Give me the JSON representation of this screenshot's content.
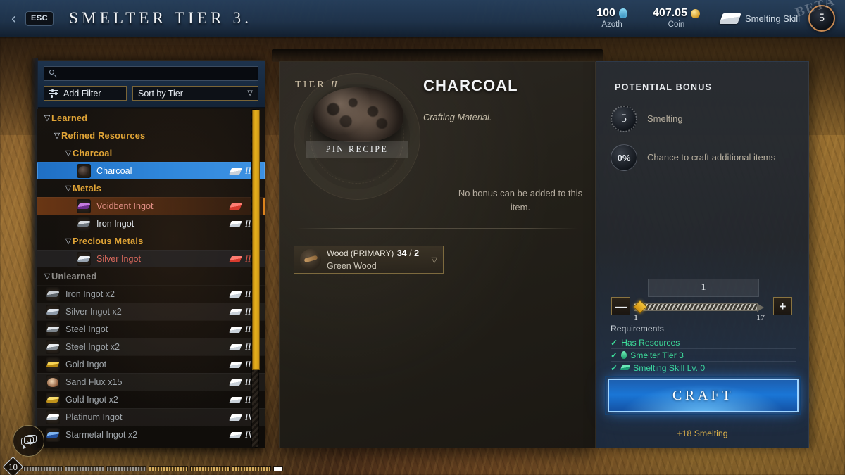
{
  "header": {
    "back_icon": "chevron-left-icon",
    "esc_key": "ESC",
    "title": "SMELTER TIER 3.",
    "azoth_value": "100",
    "azoth_label": "Azoth",
    "coin_value": "407.05",
    "coin_label": "Coin",
    "skill_label": "Smelting Skill",
    "skill_level": "5",
    "watermark": "BETA"
  },
  "sidebar": {
    "search_placeholder": "",
    "search_value": "",
    "add_filter_label": "Add Filter",
    "sort_label": "Sort by Tier",
    "groups": [
      {
        "label": "Learned",
        "depth": 0
      },
      {
        "label": "Refined Resources",
        "depth": 1
      },
      {
        "label": "Charcoal",
        "depth": 2
      }
    ],
    "items": [
      {
        "name": "Charcoal",
        "tier": "II",
        "state": "selected",
        "ingot": "white",
        "icon": "charcoal-icon"
      },
      {
        "name": "Voidbent Ingot",
        "tier": "",
        "state": "voidbent",
        "ingot": "red",
        "icon": "voidbent-ingot-icon"
      },
      {
        "name": "Iron Ingot",
        "tier": "II",
        "state": "plain",
        "ingot": "white",
        "icon": "iron-ingot-icon"
      },
      {
        "name": "Silver Ingot",
        "tier": "II",
        "state": "silver",
        "ingot": "red",
        "icon": "silver-ingot-icon"
      },
      {
        "name": "Iron Ingot x2",
        "tier": "II",
        "state": "dim",
        "ingot": "white",
        "icon": "iron-ingot-icon"
      },
      {
        "name": "Silver Ingot x2",
        "tier": "II",
        "state": "alt",
        "ingot": "white",
        "icon": "silver-ingot-icon"
      },
      {
        "name": "Steel Ingot",
        "tier": "III",
        "state": "dim",
        "ingot": "white",
        "icon": "steel-ingot-icon"
      },
      {
        "name": "Steel Ingot x2",
        "tier": "III",
        "state": "alt",
        "ingot": "white",
        "icon": "steel-ingot-icon"
      },
      {
        "name": "Gold Ingot",
        "tier": "III",
        "state": "dim",
        "ingot": "white",
        "icon": "gold-ingot-icon"
      },
      {
        "name": "Sand Flux x15",
        "tier": "III",
        "state": "alt",
        "ingot": "white",
        "icon": "sand-flux-icon"
      },
      {
        "name": "Gold Ingot x2",
        "tier": "III",
        "state": "dim",
        "ingot": "white",
        "icon": "gold-ingot-icon"
      },
      {
        "name": "Platinum Ingot",
        "tier": "IV",
        "state": "alt",
        "ingot": "white",
        "icon": "platinum-ingot-icon"
      },
      {
        "name": "Starmetal Ingot x2",
        "tier": "IV",
        "state": "dim",
        "ingot": "white",
        "icon": "starmetal-ingot-icon"
      }
    ],
    "subgroups": [
      {
        "label": "Metals",
        "after_item": 0
      },
      {
        "label": "Precious Metals",
        "after_item": 2
      },
      {
        "label": "Unlearned",
        "after_item": 3
      }
    ]
  },
  "detail": {
    "tier_prefix": "TIER",
    "tier_roman": "II",
    "pin_recipe_label": "PIN RECIPE",
    "item_name": "CHARCOAL",
    "item_type": "Crafting Material.",
    "ingredient": {
      "name": "Wood (PRIMARY)",
      "have": "34",
      "need": "2",
      "material": "Green Wood"
    },
    "no_bonus_text": "No bonus can be added to this item."
  },
  "craft": {
    "potential_bonus_title": "POTENTIAL BONUS",
    "bonuses": [
      {
        "value": "5",
        "label": "Smelting"
      },
      {
        "value": "0%",
        "label": "Chance to craft additional items"
      }
    ],
    "quantity": "1",
    "minus_label": "—",
    "plus_label": "+",
    "slider_min": "1",
    "slider_max": "17",
    "requirements_title": "Requirements",
    "requirements": [
      {
        "label": "Has Resources",
        "icon": "none",
        "met": true
      },
      {
        "label": "Smelter Tier 3",
        "icon": "flame-icon",
        "met": true
      },
      {
        "label": "Smelting Skill Lv. 0",
        "icon": "ingot-icon",
        "met": true
      }
    ],
    "craft_label": "CRAFT",
    "craft_gain": "+18 Smelting"
  },
  "hud": {
    "chat_icon": "chat-bubbles-icon",
    "level": "10"
  },
  "colors": {
    "accent_gold": "#e0a436",
    "accent_blue": "#1a76d6",
    "success_green": "#3ddc9a",
    "danger_red": "#d9564a",
    "selected_blue": "#2f86da"
  }
}
